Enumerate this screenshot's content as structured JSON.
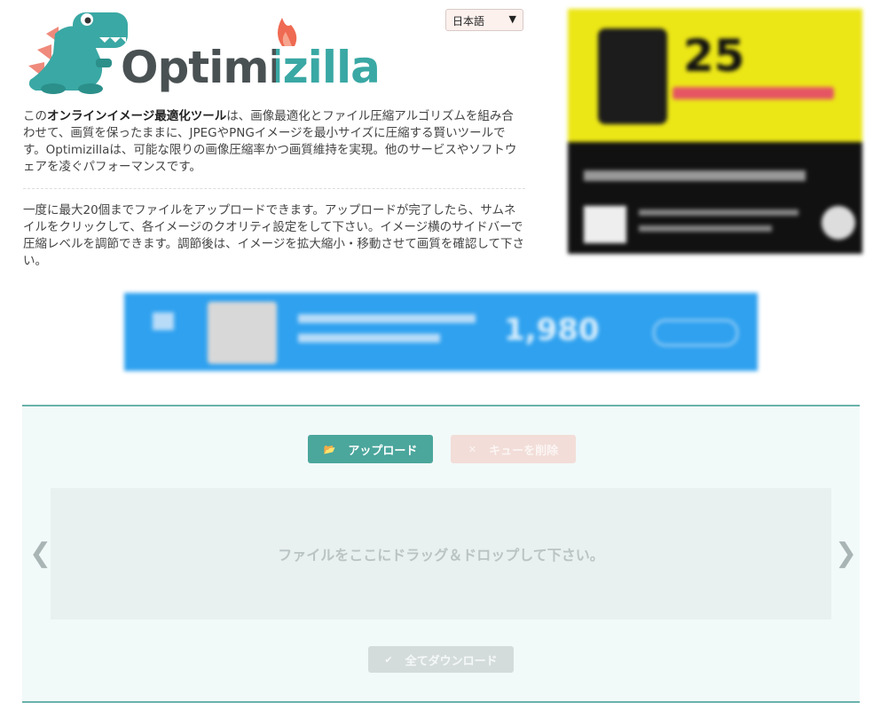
{
  "brand": {
    "logo_text": "Optimizilla",
    "colors": {
      "teal": "#3aa8a4",
      "dark": "#4a5153",
      "flame": "#ef6a52",
      "spikes": "#ef8a7c"
    }
  },
  "language": {
    "selected": "日本語"
  },
  "intro": {
    "part1": "この",
    "bold": "オンラインイメージ最適化ツール",
    "part2": "は、画像最適化とファイル圧縮アルゴリズムを組み合わせて、画質を保ったままに、JPEGやPNGイメージを最小サイズに圧縮する賢いツールです。Optimizillaは、可能な限りの画像圧縮率かつ画質維持を実現。他のサービスやソフトウェアを凌ぐパフォーマンスです。"
  },
  "info": "一度に最大20個までファイルをアップロードできます。アップロードが完了したら、サムネイルをクリックして、各イメージのクオリティ設定をして下さい。イメージ横のサイドバーで圧縮レベルを調節できます。調節後は、イメージを拡大縮小・移動させて画質を確認して下さい。",
  "ads": {
    "side": {
      "big_text": "25"
    },
    "banner": {
      "price": "1,980"
    }
  },
  "tool": {
    "upload_label": "アップロード",
    "upload_icon": "folder-open-icon",
    "clear_label": "キューを削除",
    "clear_icon": "close-icon",
    "dropzone_text": "ファイルをここにドラッグ＆ドロップして下さい。",
    "prev_glyph": "❮",
    "next_glyph": "❯",
    "download_all_label": "全てダウンロード",
    "download_all_icon": "check-icon"
  }
}
